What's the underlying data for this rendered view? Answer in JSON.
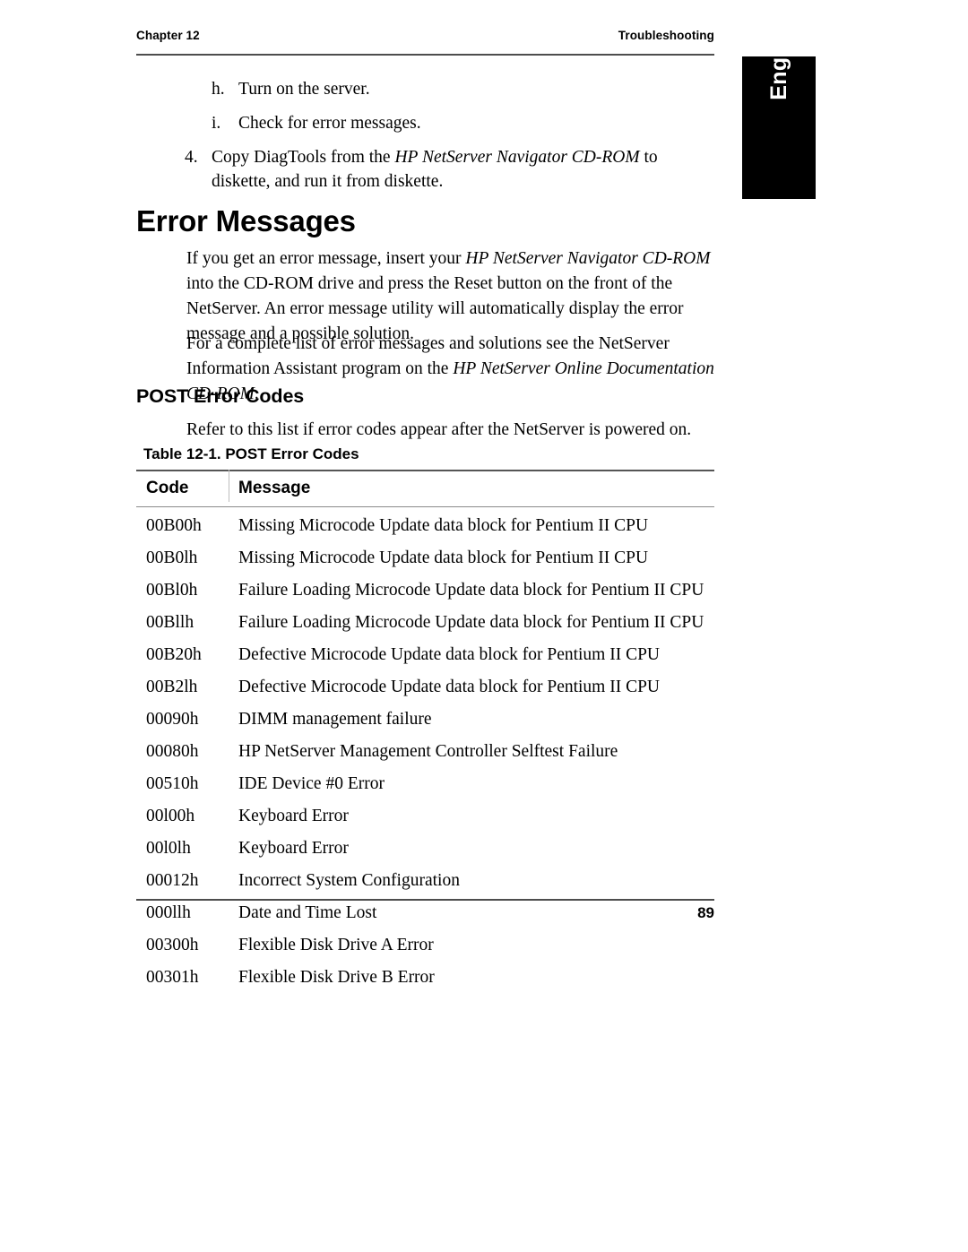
{
  "header": {
    "chapter": "Chapter 12",
    "section": "Troubleshooting"
  },
  "side_tab": {
    "label": "English"
  },
  "steps": [
    {
      "marker": "h.",
      "level": "sub",
      "text": "Turn on the server."
    },
    {
      "marker": "i.",
      "level": "sub",
      "text": "Check for error messages."
    },
    {
      "marker": "4.",
      "level": "main",
      "text_before": "Copy DiagTools from the ",
      "text_italic": "HP NetServer Navigator CD-ROM",
      "text_after": " to diskette, and run it from diskette."
    }
  ],
  "headings": {
    "h1": "Error Messages",
    "h2": "POST Error Codes"
  },
  "paragraphs": {
    "p1_before": "If you get an error message, insert your ",
    "p1_italic": "HP NetServer Navigator CD-ROM",
    "p1_after": " into the CD-ROM drive and press the Reset button on the front of the NetServer. An error message utility will automatically display the error message and a possible solution.",
    "p2_before": "For a complete list of error messages and solutions see the NetServer Information Assistant program on the ",
    "p2_italic": "HP NetServer Online Documentation CD-ROM",
    "p2_after": ".",
    "p3": "Refer to this list if error codes appear after the NetServer is powered on."
  },
  "table": {
    "caption": "Table 12-1. POST Error Codes",
    "columns": [
      "Code",
      "Message"
    ],
    "rows": [
      {
        "code": "00B00h",
        "message": "Missing Microcode Update data block for Pentium II CPU"
      },
      {
        "code": "00B0lh",
        "message": "Missing Microcode Update data block for Pentium II CPU"
      },
      {
        "code": "00Bl0h",
        "message": "Failure Loading Microcode Update data block for Pentium II CPU"
      },
      {
        "code": "00Bllh",
        "message": "Failure Loading Microcode Update data block for Pentium II CPU"
      },
      {
        "code": "00B20h",
        "message": "Defective Microcode Update data block for Pentium II CPU"
      },
      {
        "code": "00B2lh",
        "message": "Defective Microcode Update data block for Pentium II CPU"
      },
      {
        "code": "00090h",
        "message": "DIMM management failure"
      },
      {
        "code": "00080h",
        "message": "HP NetServer Management Controller Selftest Failure"
      },
      {
        "code": "00510h",
        "message": "IDE Device #0 Error"
      },
      {
        "code": "00l00h",
        "message": "Keyboard Error"
      },
      {
        "code": "00l0lh",
        "message": "Keyboard Error"
      },
      {
        "code": "00012h",
        "message": "Incorrect System Configuration"
      },
      {
        "code": "000llh",
        "message": "Date and Time Lost"
      },
      {
        "code": "00300h",
        "message": "Flexible Disk Drive A Error"
      },
      {
        "code": "00301h",
        "message": "Flexible Disk Drive B Error"
      }
    ]
  },
  "footer": {
    "page_number": "89"
  },
  "colors": {
    "text": "#000000",
    "rule": "#4d4d4d",
    "tab_background": "#000000",
    "tab_text": "#ffffff"
  }
}
